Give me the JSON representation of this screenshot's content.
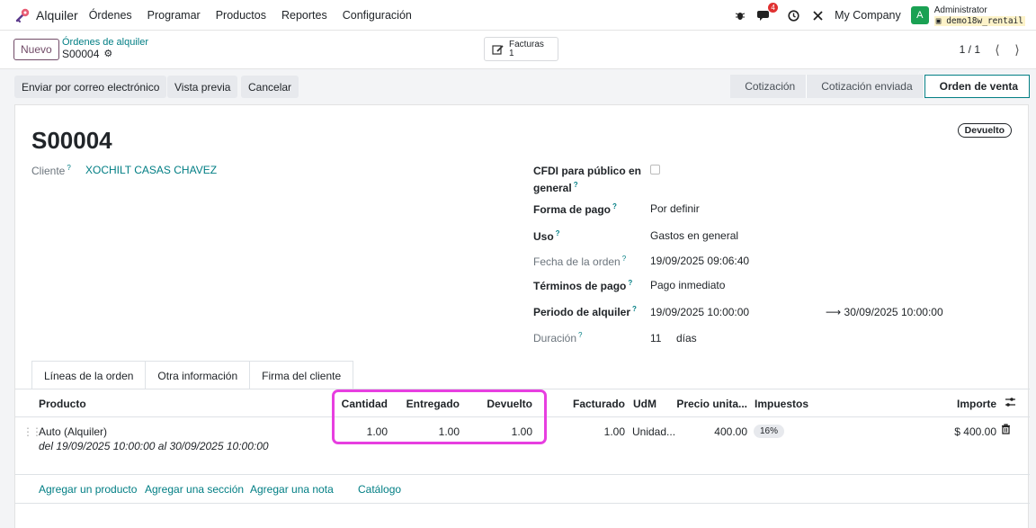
{
  "navbar": {
    "app_name": "Alquiler",
    "menu": [
      "Órdenes",
      "Programar",
      "Productos",
      "Reportes",
      "Configuración"
    ],
    "messages_badge": "4",
    "company": "My Company",
    "avatar_initial": "A",
    "user_name": "Administrator",
    "database": "demo18w_rentail"
  },
  "control": {
    "new_label": "Nuevo",
    "breadcrumb_parent": "Órdenes de alquiler",
    "breadcrumb_current": "S00004",
    "smart_label": "Facturas",
    "smart_count": "1",
    "pager": "1 / 1"
  },
  "actions": {
    "email": "Enviar por correo electrónico",
    "preview": "Vista previa",
    "cancel": "Cancelar"
  },
  "stages": [
    "Cotización",
    "Cotización enviada",
    "Orden de venta"
  ],
  "record": {
    "name": "S00004",
    "status_tag": "Devuelto",
    "customer_label": "Cliente",
    "customer": "XOCHILT CASAS CHAVEZ",
    "cfdi_label_1": "CFDI para público en",
    "cfdi_label_2": "general",
    "payment_form_label": "Forma de pago",
    "payment_form": "Por definir",
    "usage_label": "Uso",
    "usage": "Gastos en general",
    "order_date_label": "Fecha de la orden",
    "order_date": "19/09/2025 09:06:40",
    "payment_terms_label": "Términos de pago",
    "payment_terms": "Pago inmediato",
    "rental_period_label": "Periodo de alquiler",
    "rental_start": "19/09/2025 10:00:00",
    "rental_end": "30/09/2025 10:00:00",
    "duration_label": "Duración",
    "duration_value": "11",
    "duration_unit": "días"
  },
  "tabs": [
    "Líneas de la orden",
    "Otra información",
    "Firma del cliente"
  ],
  "table": {
    "headers": {
      "product": "Producto",
      "quantity": "Cantidad",
      "delivered": "Entregado",
      "returned": "Devuelto",
      "invoiced": "Facturado",
      "uom": "UdM",
      "price": "Precio unita...",
      "taxes": "Impuestos",
      "amount": "Importe"
    },
    "rows": [
      {
        "product": "Auto (Alquiler)",
        "description": "del 19/09/2025 10:00:00 al 30/09/2025 10:00:00",
        "quantity": "1.00",
        "delivered": "1.00",
        "returned": "1.00",
        "invoiced": "1.00",
        "uom": "Unidad...",
        "price": "400.00",
        "tax": "16%",
        "amount": "$ 400.00"
      }
    ],
    "add_links": [
      "Agregar un producto",
      "Agregar una sección",
      "Agregar una nota",
      "Catálogo"
    ]
  }
}
